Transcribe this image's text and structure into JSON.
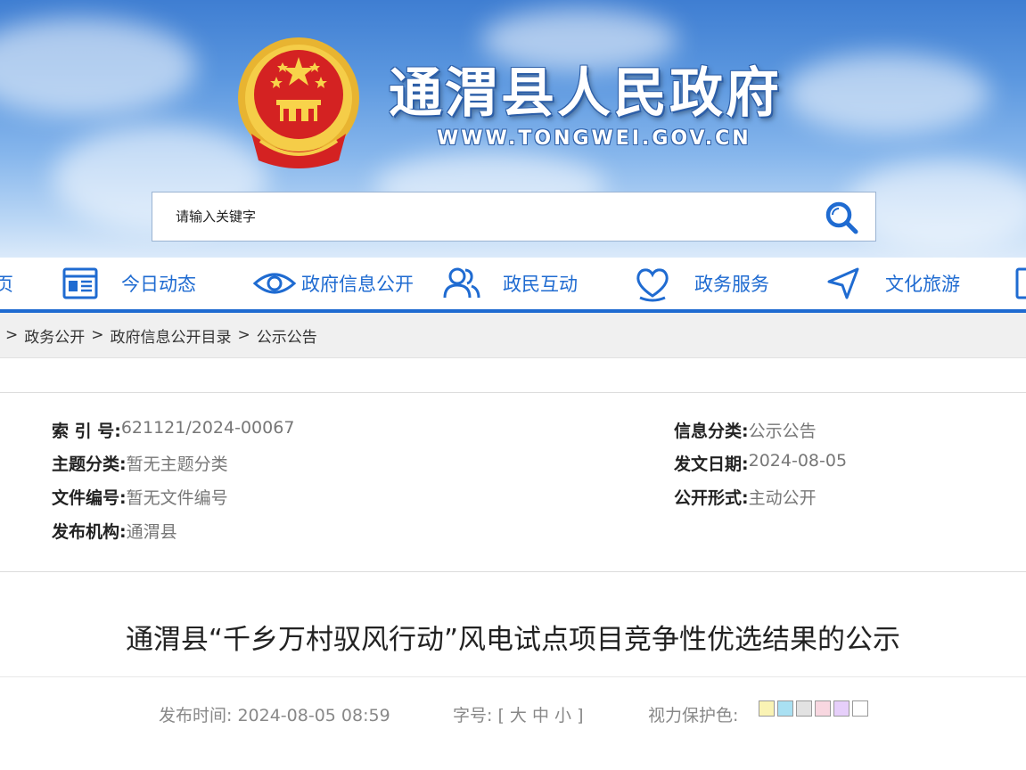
{
  "header": {
    "site_title": "通渭县人民政府",
    "site_url": "WWW.TONGWEI.GOV.CN",
    "search_placeholder": "请输入关键字"
  },
  "nav": {
    "partial_left_label": "页",
    "items": [
      {
        "label": "今日动态",
        "icon": "news-icon"
      },
      {
        "label": "政府信息公开",
        "icon": "eye-icon"
      },
      {
        "label": "政民互动",
        "icon": "users-icon"
      },
      {
        "label": "政务服务",
        "icon": "heart-icon"
      },
      {
        "label": "文化旅游",
        "icon": "navigation-icon"
      }
    ]
  },
  "breadcrumb": {
    "items": [
      "政务公开",
      "政府信息公开目录",
      "公示公告"
    ],
    "separator": ">"
  },
  "meta": {
    "index_no_key": "索 引 号:",
    "index_no_val": "621121/2024-00067",
    "topic_key": "主题分类:",
    "topic_val": "暂无主题分类",
    "doc_no_key": "文件编号:",
    "doc_no_val": "暂无文件编号",
    "publisher_key": "发布机构:",
    "publisher_val": "通渭县",
    "category_key": "信息分类:",
    "category_val": "公示公告",
    "date_key": "发文日期:",
    "date_val": "2024-08-05",
    "form_key": "公开形式:",
    "form_val": "主动公开"
  },
  "article": {
    "title": "通渭县“千乡万村驭风行动”风电试点项目竞争性优选结果的公示",
    "publish_time_label": "发布时间:",
    "publish_time": "2024-08-05 08:59",
    "font_size_label": "字号:",
    "font_size_open": "[",
    "font_size_large": "大",
    "font_size_medium": "中",
    "font_size_small": "小",
    "font_size_close": "]",
    "eye_care_label": "视力保护色:"
  },
  "colors": {
    "accent": "#1f6bd1",
    "swatches": [
      "#faf3b4",
      "#a9e0f2",
      "#e2e2e2",
      "#f8d7e0",
      "#e6cffa",
      "#ffffff"
    ]
  }
}
